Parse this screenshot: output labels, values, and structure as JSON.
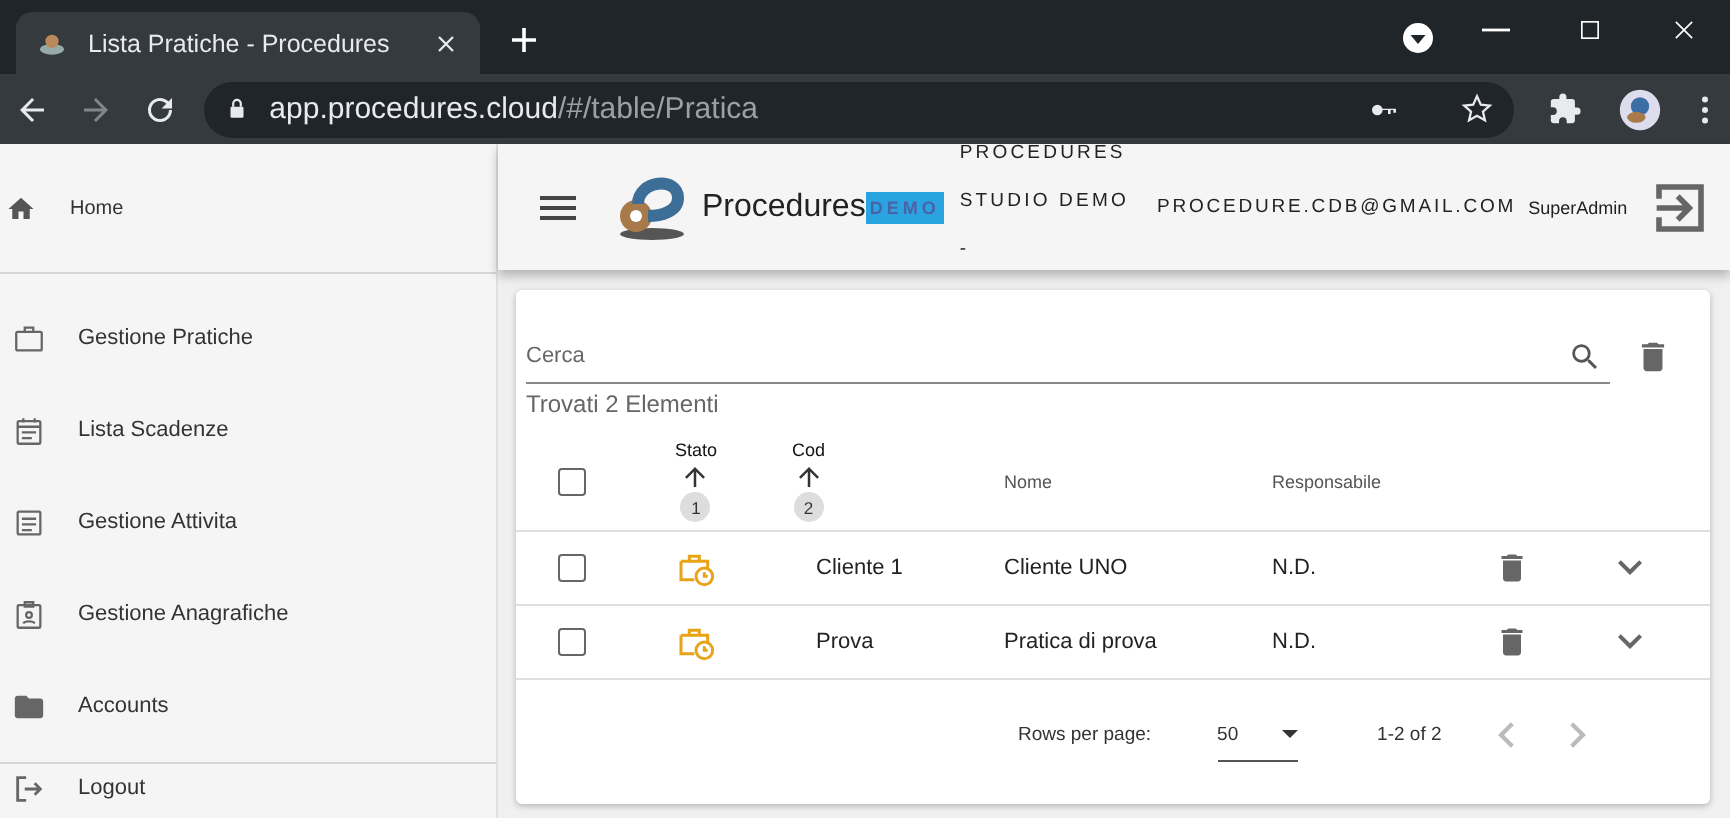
{
  "browser": {
    "tab_title": "Lista Pratiche - Procedures",
    "url_host": "app.procedures.cloud",
    "url_path": "/#/table/Pratica"
  },
  "sidebar": {
    "groups": [
      [
        {
          "label": "Home",
          "kind": "home"
        }
      ],
      [
        {
          "label": "Gestione Pratiche",
          "kind": "briefcase"
        },
        {
          "label": "Lista Scadenze",
          "kind": "calendar"
        },
        {
          "label": "Gestione Attivita",
          "kind": "document"
        },
        {
          "label": "Gestione Anagrafiche",
          "kind": "badge"
        },
        {
          "label": "Accounts",
          "kind": "folder"
        }
      ],
      [
        {
          "label": "Logout",
          "kind": "logout"
        }
      ]
    ]
  },
  "header": {
    "brand": "Procedures",
    "badge": "DEMO",
    "org_lines": [
      "PROCEDURES",
      "STUDIO DEMO",
      "-"
    ],
    "email": "PROCEDURE.CDB@GMAIL.COM",
    "role": "SuperAdmin"
  },
  "search": {
    "placeholder": "Cerca"
  },
  "result_count": "Trovati 2 Elementi",
  "table": {
    "all_selected": false,
    "columns": [
      {
        "label": "Stato",
        "sort_order": "1"
      },
      {
        "label": "Cod",
        "sort_order": "2"
      },
      {
        "label": "Nome"
      },
      {
        "label": "Responsabile"
      }
    ],
    "rows": [
      {
        "selected": false,
        "cod": "Cliente 1",
        "nome": "Cliente UNO",
        "responsabile": "N.D."
      },
      {
        "selected": false,
        "cod": "Prova",
        "nome": "Pratica di prova",
        "responsabile": "N.D."
      }
    ]
  },
  "pagination": {
    "label": "Rows per page:",
    "rows_per_page": "50",
    "range": "1-2 of 2"
  }
}
